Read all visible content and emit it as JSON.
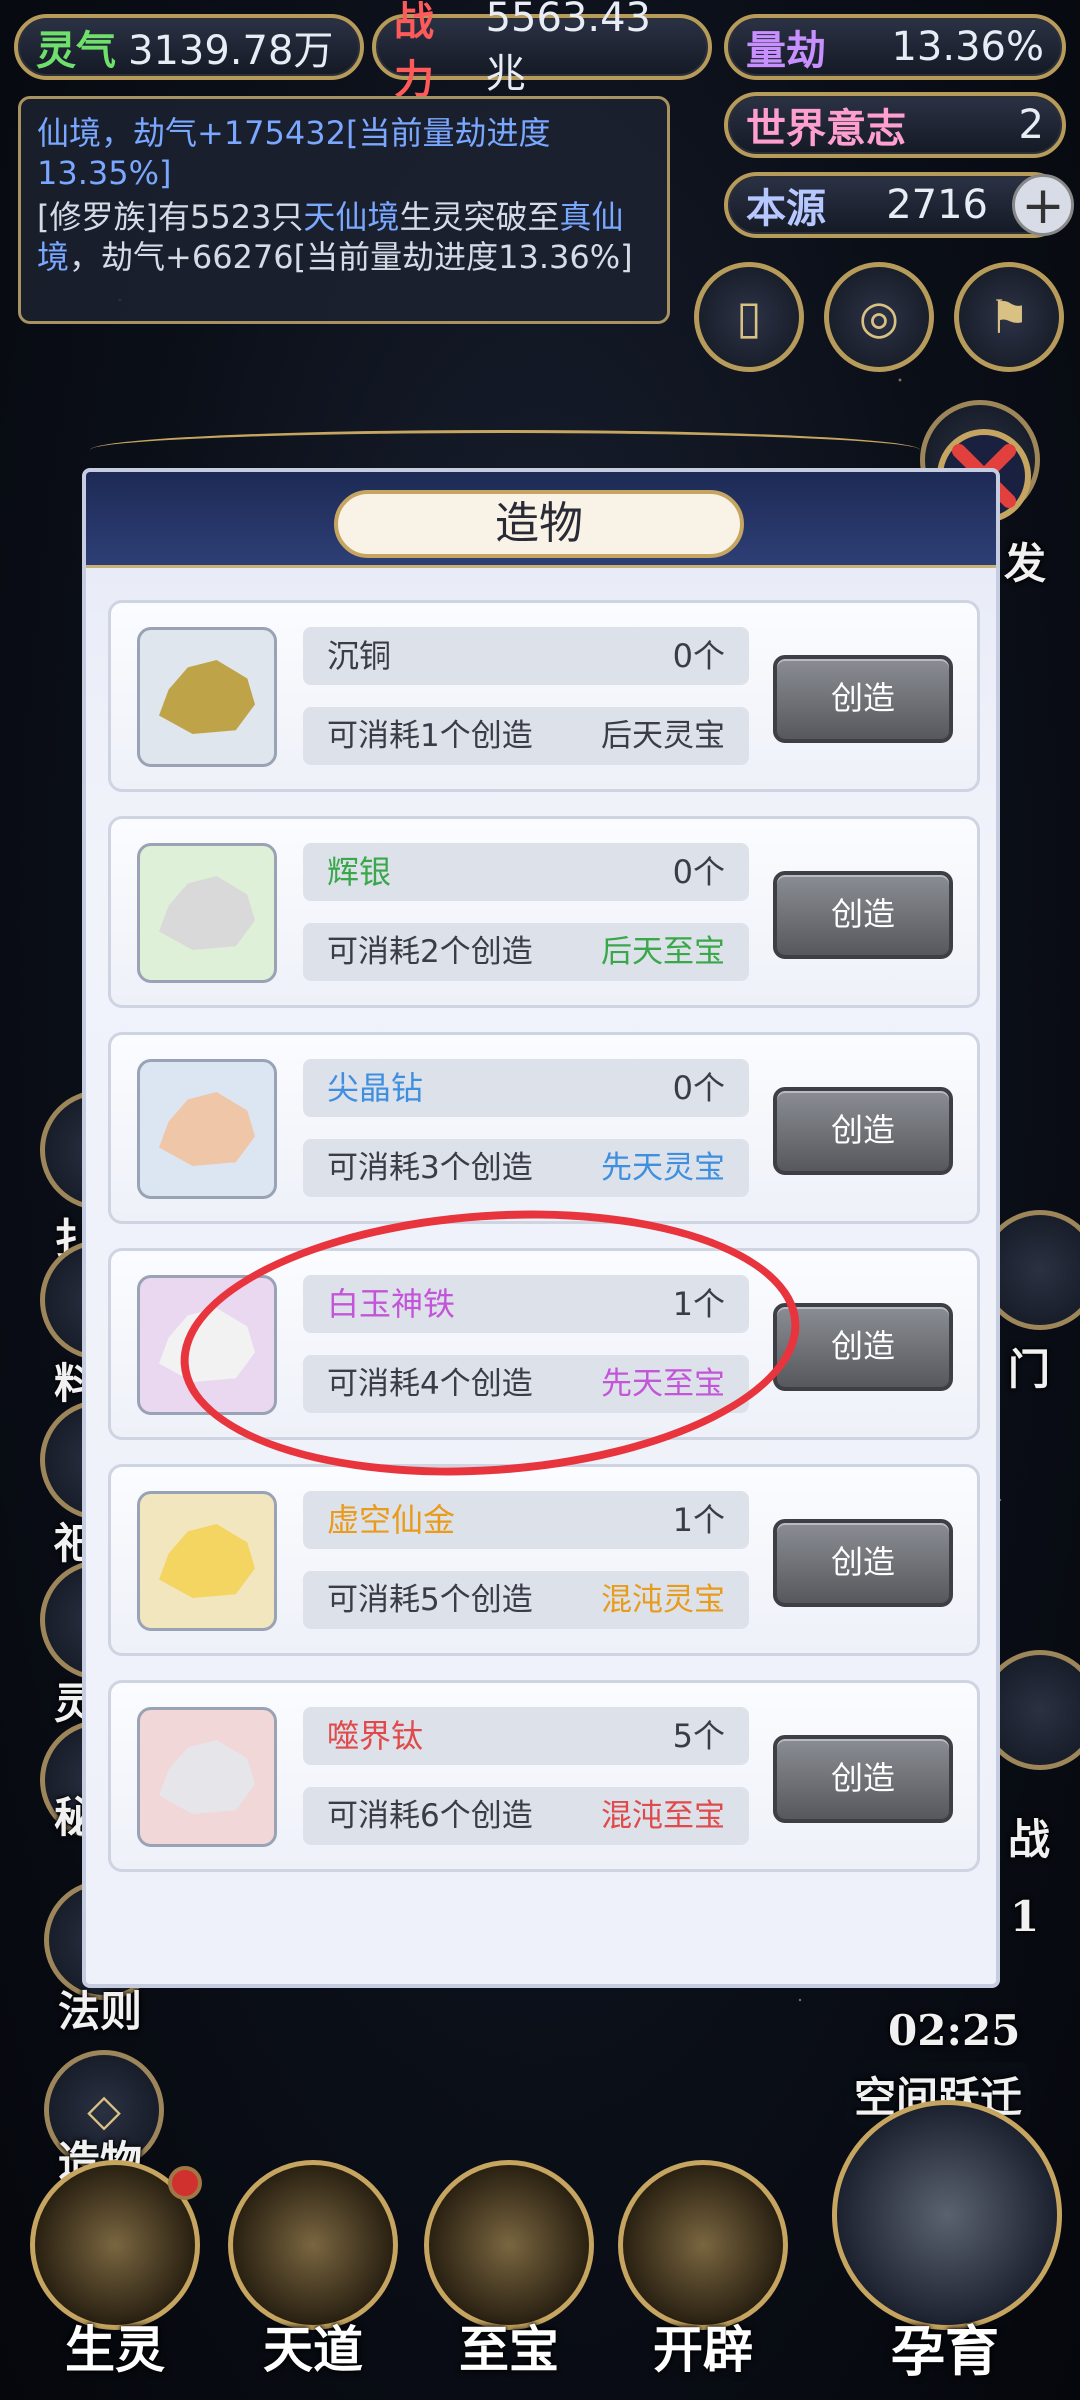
{
  "status": {
    "lingqi": {
      "label": "灵气",
      "value": "3139.78万"
    },
    "zhanli": {
      "label": "战力",
      "value": "5563.43兆"
    },
    "liangjie": {
      "label": "量劫",
      "value": "13.36%"
    },
    "shijie": {
      "label": "世界意志",
      "value": "2"
    },
    "benyuan": {
      "label": "本源",
      "value": "2716"
    }
  },
  "log": {
    "line1": "仙境，劫气+175432[当前量劫进度13.35%]",
    "line2_pre": "[修罗族]有5523只",
    "line2_hl1": "天仙境",
    "line2_mid": "生灵突破至",
    "line2_hl2": "真仙境",
    "line2_post": "，劫气+66276[当前量劫进度13.36%]"
  },
  "side": {
    "right_fa": "发",
    "right_men": "门",
    "right_zhan": "战",
    "right_one": "1",
    "timer": "02:25",
    "kongjian": "空间跃迁",
    "fazhe": "法则",
    "zaowu": "造物",
    "left_chars": [
      "扌",
      "料",
      "祀",
      "灵",
      "秘"
    ]
  },
  "nav": [
    "生灵",
    "天道",
    "至宝",
    "开辟",
    "孕育"
  ],
  "modal": {
    "title": "造物",
    "create_label": "创造",
    "items": [
      {
        "name": "沉铜",
        "count": "0个",
        "cost": "可消耗1个创造",
        "grade": "后天灵宝",
        "color": "#3a3d48",
        "grade_color": "#3a3d48",
        "thumb_bg": "#dfe6ee",
        "rock": "#bfa348"
      },
      {
        "name": "辉银",
        "count": "0个",
        "cost": "可消耗2个创造",
        "grade": "后天至宝",
        "color": "#3aa84a",
        "grade_color": "#3aa84a",
        "thumb_bg": "#dff0d8",
        "rock": "#d9d9d9"
      },
      {
        "name": "尖晶钻",
        "count": "0个",
        "cost": "可消耗3个创造",
        "grade": "先天灵宝",
        "color": "#3f8fe0",
        "grade_color": "#3f8fe0",
        "thumb_bg": "#dbe6f2",
        "rock": "#f0c6a8"
      },
      {
        "name": "白玉神铁",
        "count": "1个",
        "cost": "可消耗4个创造",
        "grade": "先天至宝",
        "color": "#c355d9",
        "grade_color": "#c355d9",
        "thumb_bg": "#ead8f1",
        "rock": "#f2f2f2"
      },
      {
        "name": "虚空仙金",
        "count": "1个",
        "cost": "可消耗5个创造",
        "grade": "混沌灵宝",
        "color": "#e99b1a",
        "grade_color": "#e99b1a",
        "thumb_bg": "#f2e6bf",
        "rock": "#f4d561"
      },
      {
        "name": "噬界钛",
        "count": "5个",
        "cost": "可消耗6个创造",
        "grade": "混沌至宝",
        "color": "#e04a4a",
        "grade_color": "#e04a4a",
        "thumb_bg": "#f1d7d7",
        "rock": "#e6e6ea"
      }
    ]
  }
}
